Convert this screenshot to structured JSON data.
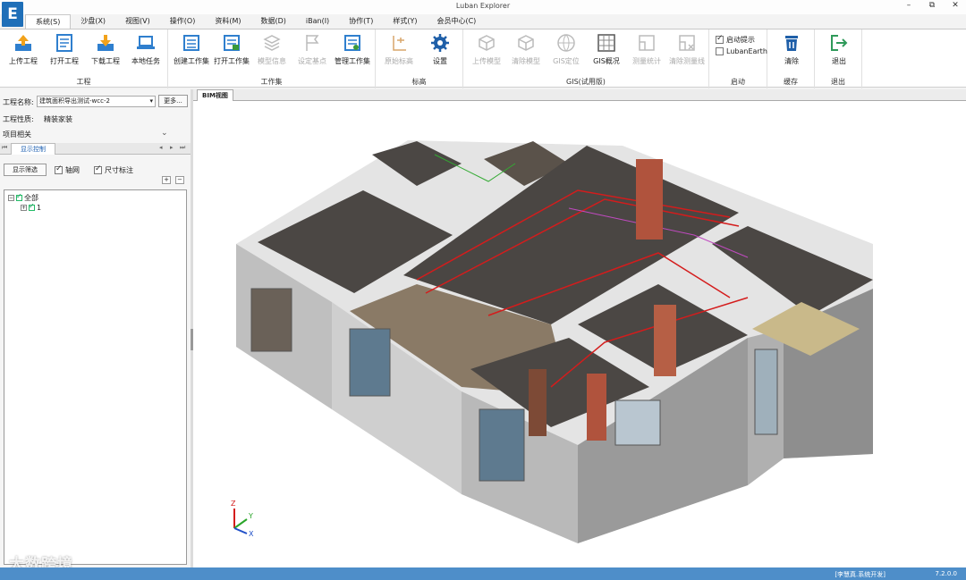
{
  "app": {
    "title": "Luban Explorer",
    "logo_letter": "E"
  },
  "window": {
    "minimize": "–",
    "restore": "⧉",
    "close": "✕"
  },
  "menu": [
    "系统(S)",
    "沙盘(X)",
    "视图(V)",
    "操作(O)",
    "资料(M)",
    "数据(D)",
    "iBan(I)",
    "协作(T)",
    "样式(Y)",
    "会员中心(C)"
  ],
  "ribbon": {
    "groups": {
      "project": "工程",
      "workset": "工作集",
      "mark": "标高",
      "gis": "GIS(试用版)",
      "startup": "启动",
      "cache": "缓存",
      "exit": "退出"
    },
    "buttons": {
      "upload": "上传工程",
      "open": "打开工程",
      "download": "下载工程",
      "local_task": "本地任务",
      "create_ws": "创建工作集",
      "open_ws": "打开工作集",
      "model_info": "模型信息",
      "set_base": "设定基点",
      "manage_ws": "管理工作集",
      "orig_mark": "原始标高",
      "settings": "设置",
      "upload_model": "上传模型",
      "clear_model": "清除模型",
      "gis_locate": "GIS定位",
      "gis_overview": "GIS概况",
      "measure": "测量统计",
      "clear_measure": "清除测量线",
      "clear": "清除",
      "exit": "退出"
    },
    "checks": {
      "startup_tip": "启动提示",
      "luban_earth": "LubanEarth"
    }
  },
  "left_panel": {
    "project_name_label": "工程名称:",
    "project_name_value": "建筑面积导出测试-wcc-2",
    "more_button": "更多...",
    "project_type_label": "工程性质:",
    "project_type_value": "精装家装",
    "project_related": "项目相关",
    "tab_display": "显示控制",
    "filter_button": "显示筛选",
    "chk_axis": "轴网",
    "chk_dim": "尺寸标注",
    "plus": "+",
    "minus": "−",
    "tree": {
      "root": "全部",
      "child": "1"
    }
  },
  "viewport": {
    "tab": "BIM视图",
    "axis_z": "Z",
    "axis_y": "Y",
    "axis_x": "X"
  },
  "watermark": "大数跨境",
  "statusbar": {
    "user": "[李慧真.系统开发]",
    "version": "7.2.0.0"
  }
}
